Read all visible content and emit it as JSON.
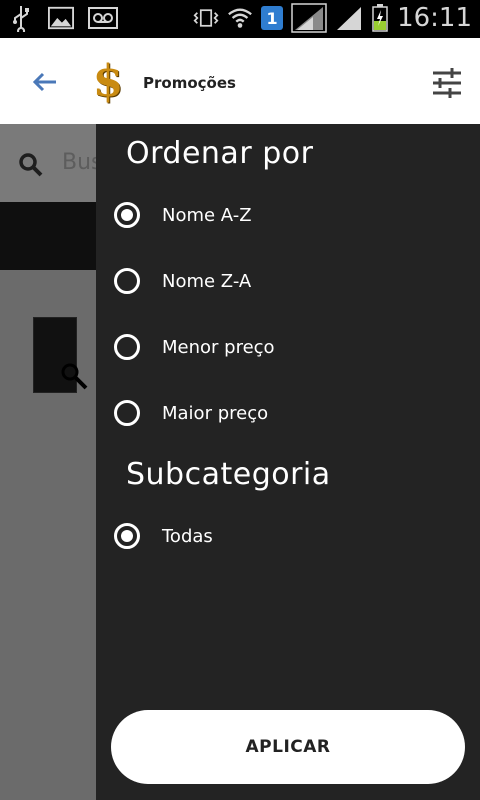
{
  "status_bar": {
    "time": "16:11",
    "sim_badge": "1",
    "icons": [
      "usb-icon",
      "image-icon",
      "voicemail-icon",
      "vibrate-icon",
      "wifi-icon",
      "signal-icon",
      "battery-icon"
    ]
  },
  "app_bar": {
    "title": "Promoções",
    "logo_symbol": "$",
    "back_icon": "arrow-left-icon",
    "filter_icon": "sliders-icon",
    "accent_color": "#4a78b8"
  },
  "background": {
    "search_placeholder": "Bus"
  },
  "drawer": {
    "sort_title": "Ordenar por",
    "sort_options": [
      {
        "label": "Nome A-Z",
        "selected": true
      },
      {
        "label": "Nome Z-A",
        "selected": false
      },
      {
        "label": "Menor preço",
        "selected": false
      },
      {
        "label": "Maior preço",
        "selected": false
      }
    ],
    "subcategory_title": "Subcategoria",
    "subcategory_options": [
      {
        "label": "Todas",
        "selected": true
      }
    ],
    "apply_label": "APLICAR"
  }
}
